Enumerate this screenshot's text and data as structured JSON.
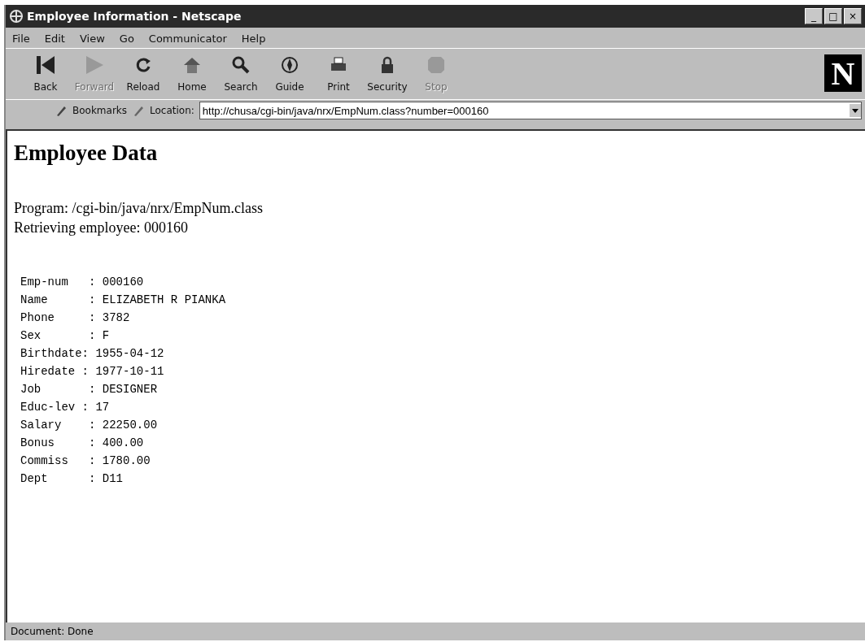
{
  "window": {
    "title": "Employee Information - Netscape",
    "controls": [
      "_",
      "□",
      "×"
    ]
  },
  "menu": [
    "File",
    "Edit",
    "View",
    "Go",
    "Communicator",
    "Help"
  ],
  "toolbar": [
    {
      "label": "Back",
      "disabled": false
    },
    {
      "label": "Forward",
      "disabled": true
    },
    {
      "label": "Reload",
      "disabled": false
    },
    {
      "label": "Home",
      "disabled": false
    },
    {
      "label": "Search",
      "disabled": false
    },
    {
      "label": "Guide",
      "disabled": false
    },
    {
      "label": "Print",
      "disabled": false
    },
    {
      "label": "Security",
      "disabled": false
    },
    {
      "label": "Stop",
      "disabled": true
    }
  ],
  "logo": "N",
  "location_bar": {
    "bookmarks": "Bookmarks",
    "location_label": "Location:",
    "url": "http://chusa/cgi-bin/java/nrx/EmpNum.class?number=000160"
  },
  "page": {
    "heading": "Employee Data",
    "lines": [
      "Program: /cgi-bin/java/nrx/EmpNum.class",
      "Retrieving employee: 000160"
    ],
    "record": [
      "Emp-num   : 000160",
      "Name      : ELIZABETH R PIANKA",
      "Phone     : 3782",
      "Sex       : F",
      "Birthdate: 1955-04-12",
      "Hiredate : 1977-10-11",
      "Job       : DESIGNER",
      "Educ-lev : 17",
      "Salary    : 22250.00",
      "Bonus     : 400.00",
      "Commiss   : 1780.00",
      "Dept      : D11"
    ]
  },
  "status_bar": "Document: Done"
}
